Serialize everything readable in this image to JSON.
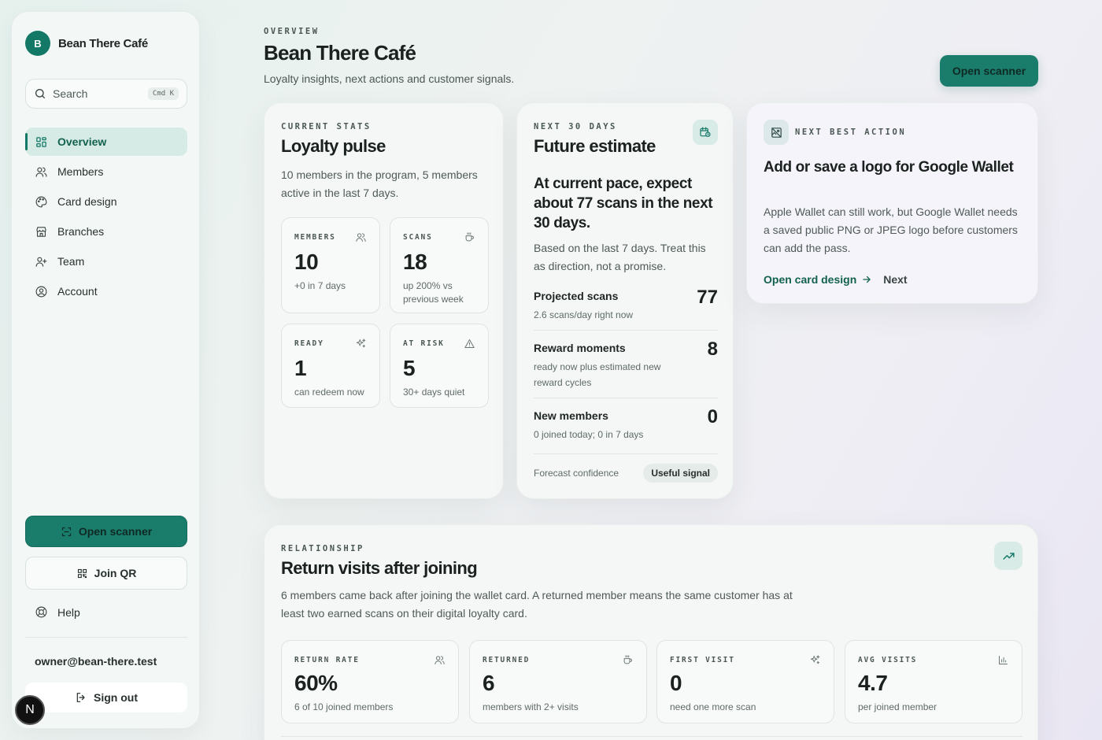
{
  "brand": {
    "logo_letter": "B",
    "name": "Bean There Café"
  },
  "search": {
    "placeholder": "Search",
    "shortcut": "Cmd K"
  },
  "sidebar": {
    "items": [
      {
        "label": "Overview",
        "icon": "grid-icon",
        "active": true
      },
      {
        "label": "Members",
        "icon": "users-icon"
      },
      {
        "label": "Card design",
        "icon": "palette-icon"
      },
      {
        "label": "Branches",
        "icon": "store-icon"
      },
      {
        "label": "Team",
        "icon": "user-plus-icon"
      },
      {
        "label": "Account",
        "icon": "user-circle-icon"
      }
    ],
    "open_scanner": "Open scanner",
    "join_qr": "Join QR",
    "help": "Help",
    "owner_email": "owner@bean-there.test",
    "sign_out": "Sign out",
    "avatar_letter": "N"
  },
  "header": {
    "eyebrow": "OVERVIEW",
    "title": "Bean There Café",
    "subtitle": "Loyalty insights, next actions and customer signals.",
    "open_scanner": "Open scanner"
  },
  "stats": {
    "eyebrow": "CURRENT STATS",
    "title": "Loyalty pulse",
    "description": "10 members in the program, 5 members active in the last 7 days.",
    "tiles": [
      {
        "label": "MEMBERS",
        "value": "10",
        "note": "+0 in 7 days",
        "icon": "users-icon"
      },
      {
        "label": "SCANS",
        "value": "18",
        "note": "up 200% vs previous week",
        "icon": "coffee-cup-icon"
      },
      {
        "label": "READY",
        "value": "1",
        "note": "can redeem now",
        "icon": "sparkles-icon"
      },
      {
        "label": "AT RISK",
        "value": "5",
        "note": "30+ days quiet",
        "icon": "warning-icon"
      }
    ]
  },
  "future": {
    "eyebrow": "NEXT 30 DAYS",
    "title": "Future estimate",
    "headline": "At current pace, expect about 77 scans in the next 30 days.",
    "description": "Based on the last 7 days. Treat this as direction, not a promise.",
    "metrics": [
      {
        "label": "Projected scans",
        "note": "2.6 scans/day right now",
        "value": "77"
      },
      {
        "label": "Reward moments",
        "note": "ready now plus estimated new reward cycles",
        "value": "8"
      },
      {
        "label": "New members",
        "note": "0 joined today; 0 in 7 days",
        "value": "0"
      }
    ],
    "confidence_label": "Forecast confidence",
    "confidence_value": "Useful signal"
  },
  "next_action": {
    "eyebrow": "NEXT BEST ACTION",
    "title": "Add or save a logo for Google Wallet",
    "description": "Apple Wallet can still work, but Google Wallet needs a saved public PNG or JPEG logo before customers can add the pass.",
    "primary_link": "Open card design",
    "secondary_link": "Next"
  },
  "relationship": {
    "eyebrow": "RELATIONSHIP",
    "title": "Return visits after joining",
    "description": "6 members came back after joining the wallet card. A returned member means the same customer has at least two earned scans on their digital loyalty card.",
    "tiles": [
      {
        "label": "RETURN RATE",
        "value": "60%",
        "note": "6 of 10 joined members",
        "icon": "users-icon"
      },
      {
        "label": "RETURNED",
        "value": "6",
        "note": "members with 2+ visits",
        "icon": "coffee-cup-icon"
      },
      {
        "label": "FIRST VISIT",
        "value": "0",
        "note": "need one more scan",
        "icon": "sparkles-icon"
      },
      {
        "label": "AVG VISITS",
        "value": "4.7",
        "note": "per joined member",
        "icon": "bar-chart-icon"
      }
    ]
  },
  "colors": {
    "accent": "#1a7c6b",
    "accent_dark": "#12614f",
    "accent_soft": "#d6ebe6"
  }
}
